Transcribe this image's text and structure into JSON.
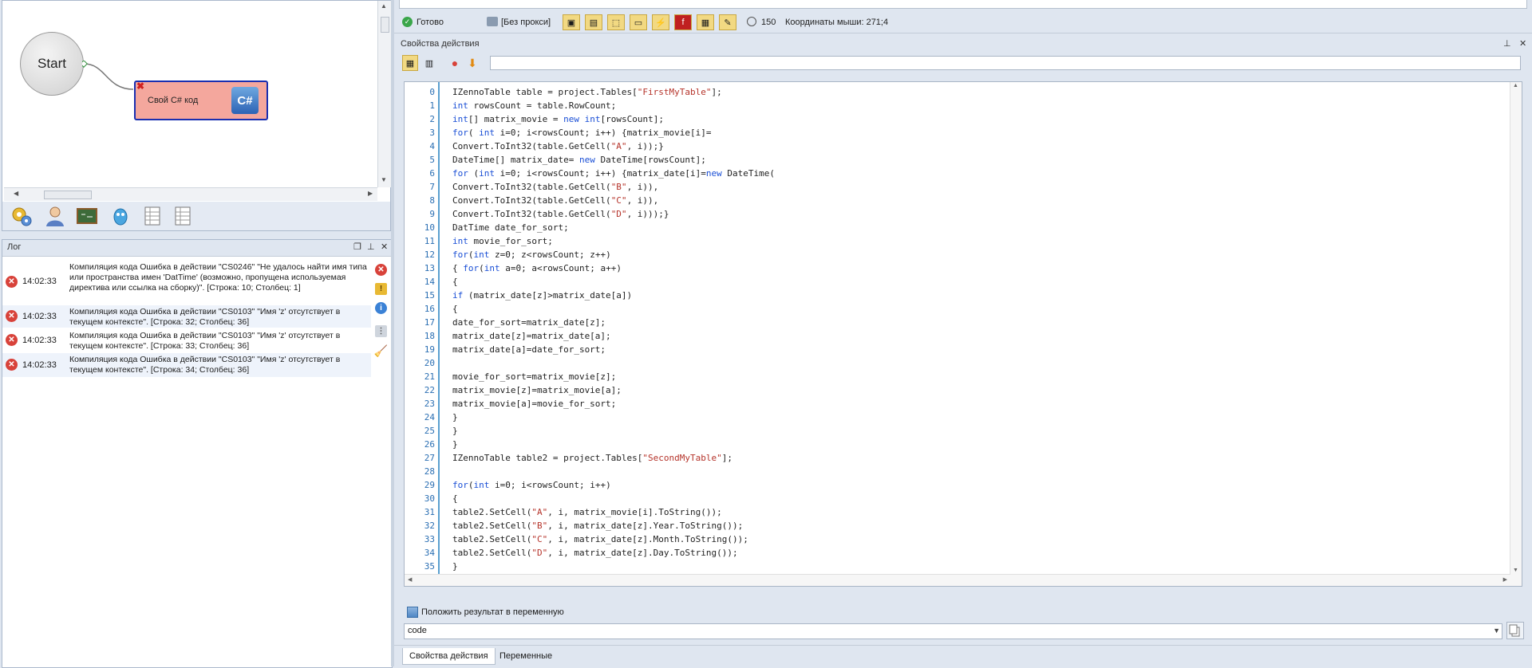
{
  "canvas": {
    "start_label": "Start",
    "code_node_label": "Свой C# код",
    "code_node_icon": "C#"
  },
  "log": {
    "title": "Лог",
    "entries": [
      {
        "time": "14:02:33",
        "message": "Компиляция кода  Ошибка в действии \"CS0246\" \"Не удалось найти имя типа или пространства имен 'DatTime' (возможно, пропущена используемая директива или ссылка на сборку)\". [Строка: 10; Столбец: 1]"
      },
      {
        "time": "14:02:33",
        "message": "Компиляция кода  Ошибка в действии \"CS0103\" \"Имя 'z' отсутствует в текущем контексте\". [Строка: 32; Столбец: 36]"
      },
      {
        "time": "14:02:33",
        "message": "Компиляция кода  Ошибка в действии \"CS0103\" \"Имя 'z' отсутствует в текущем контексте\". [Строка: 33; Столбец: 36]"
      },
      {
        "time": "14:02:33",
        "message": "Компиляция кода  Ошибка в действии \"CS0103\" \"Имя 'z' отсутствует в текущем контексте\". [Строка: 34; Столбец: 36]"
      }
    ]
  },
  "status": {
    "ready": "Готово",
    "proxy": "[Без прокси]",
    "timer": "150",
    "mouse_coords": "Координаты мыши: 271;4"
  },
  "props": {
    "title": "Свойства действия",
    "result_to_var": "Положить результат в переменную",
    "var_value": "code",
    "tabs": [
      "Свойства действия",
      "Переменные"
    ]
  },
  "code_lines": [
    "IZennoTable table = project.Tables[\"FirstMyTable\"];",
    "int rowsCount = table.RowCount;",
    "int[] matrix_movie = new int[rowsCount];",
    "for( int i=0; i<rowsCount; i++) {matrix_movie[i]=",
    "Convert.ToInt32(table.GetCell(\"A\", i));}",
    "DateTime[] matrix_date= new DateTime[rowsCount];",
    "for (int i=0; i<rowsCount; i++) {matrix_date[i]=new DateTime(",
    "Convert.ToInt32(table.GetCell(\"B\", i)),",
    "Convert.ToInt32(table.GetCell(\"C\", i)),",
    "Convert.ToInt32(table.GetCell(\"D\", i)));}",
    "DatTime date_for_sort;",
    "int movie_for_sort;",
    "for(int z=0; z<rowsCount; z++)",
    "{ for(int a=0; a<rowsCount; a++)",
    "{",
    "if (matrix_date[z]>matrix_date[a])",
    "{",
    "date_for_sort=matrix_date[z];",
    "matrix_date[z]=matrix_date[a];",
    "matrix_date[a]=date_for_sort;",
    "",
    "movie_for_sort=matrix_movie[z];",
    "matrix_movie[z]=matrix_movie[a];",
    "matrix_movie[a]=movie_for_sort;",
    "}",
    "}",
    "}",
    "IZennoTable table2 = project.Tables[\"SecondMyTable\"];",
    "",
    "for(int i=0; i<rowsCount; i++)",
    "{",
    "table2.SetCell(\"A\", i, matrix_movie[i].ToString());",
    "table2.SetCell(\"B\", i, matrix_date[z].Year.ToString());",
    "table2.SetCell(\"C\", i, matrix_date[z].Month.ToString());",
    "table2.SetCell(\"D\", i, matrix_date[z].Day.ToString());",
    "}"
  ],
  "line_numbers": [
    "0",
    "1",
    "2",
    "3",
    "4",
    "5",
    "6",
    "7",
    "8",
    "9",
    "10",
    "11",
    "12",
    "13",
    "14",
    "15",
    "16",
    "17",
    "18",
    "19",
    "20",
    "21",
    "22",
    "23",
    "24",
    "25",
    "26",
    "27",
    "28",
    "29",
    "30",
    "31",
    "32",
    "33",
    "34",
    "35"
  ],
  "colors": {
    "keyword": "#1a4fd6",
    "string": "#b5332a",
    "error": "#d8423a",
    "accent": "#f2d982"
  }
}
